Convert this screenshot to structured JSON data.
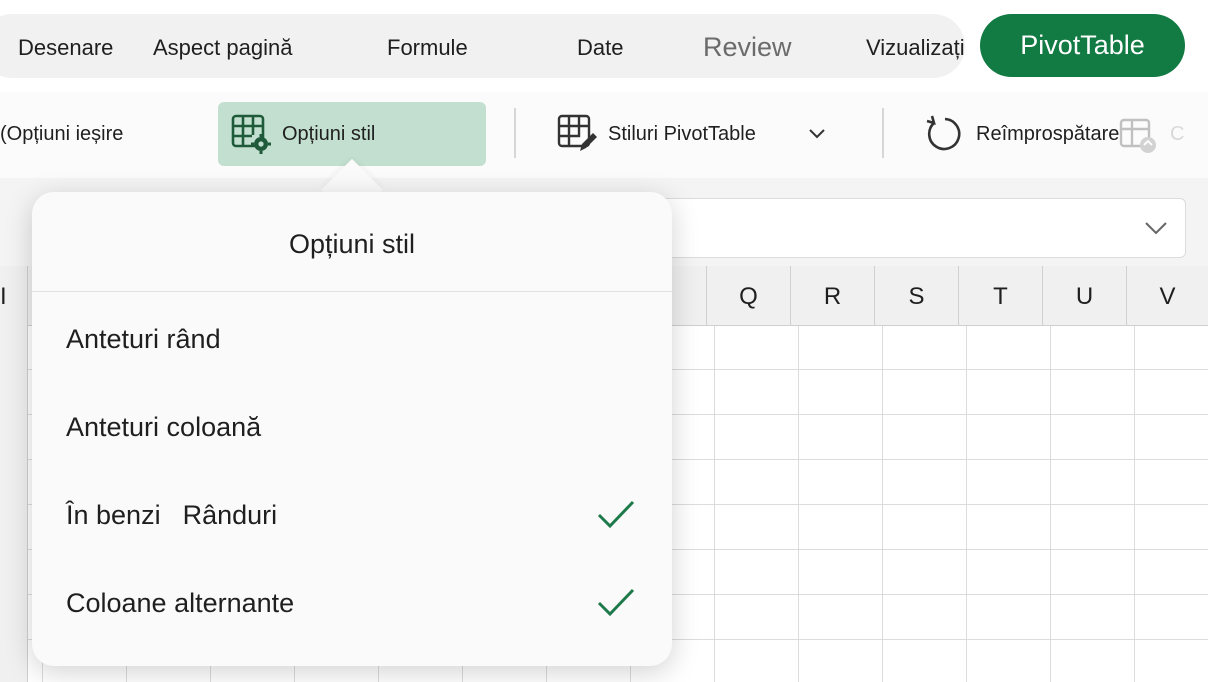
{
  "tabs": {
    "draw": "Desenare",
    "page_layout": "Aspect pagină",
    "formulas": "Formule",
    "data": "Date",
    "review": "Review",
    "view": "Vizualizați",
    "pivottable": "PivotTable"
  },
  "ribbon": {
    "output_options": "(Opțiuni ieșire",
    "style_options": "Opțiuni stil",
    "pivot_styles": "Stiluri PivotTable",
    "refresh": "Reîmprospătare",
    "cut_label": "C"
  },
  "columns": [
    "Q",
    "R",
    "S",
    "T",
    "U",
    "V"
  ],
  "left_partial_col": "I",
  "popover": {
    "title": "Opțiuni stil",
    "options": [
      {
        "label": "Anteturi rând",
        "checked": false
      },
      {
        "label": "Anteturi coloană",
        "checked": false
      },
      {
        "label": "În benzi",
        "label2": "Rânduri",
        "checked": true
      },
      {
        "label": "Coloane alternante",
        "checked": true
      }
    ]
  },
  "colors": {
    "accent": "#127a43",
    "ribbon_selected": "#c3dfcf",
    "check": "#1e7a4a"
  }
}
